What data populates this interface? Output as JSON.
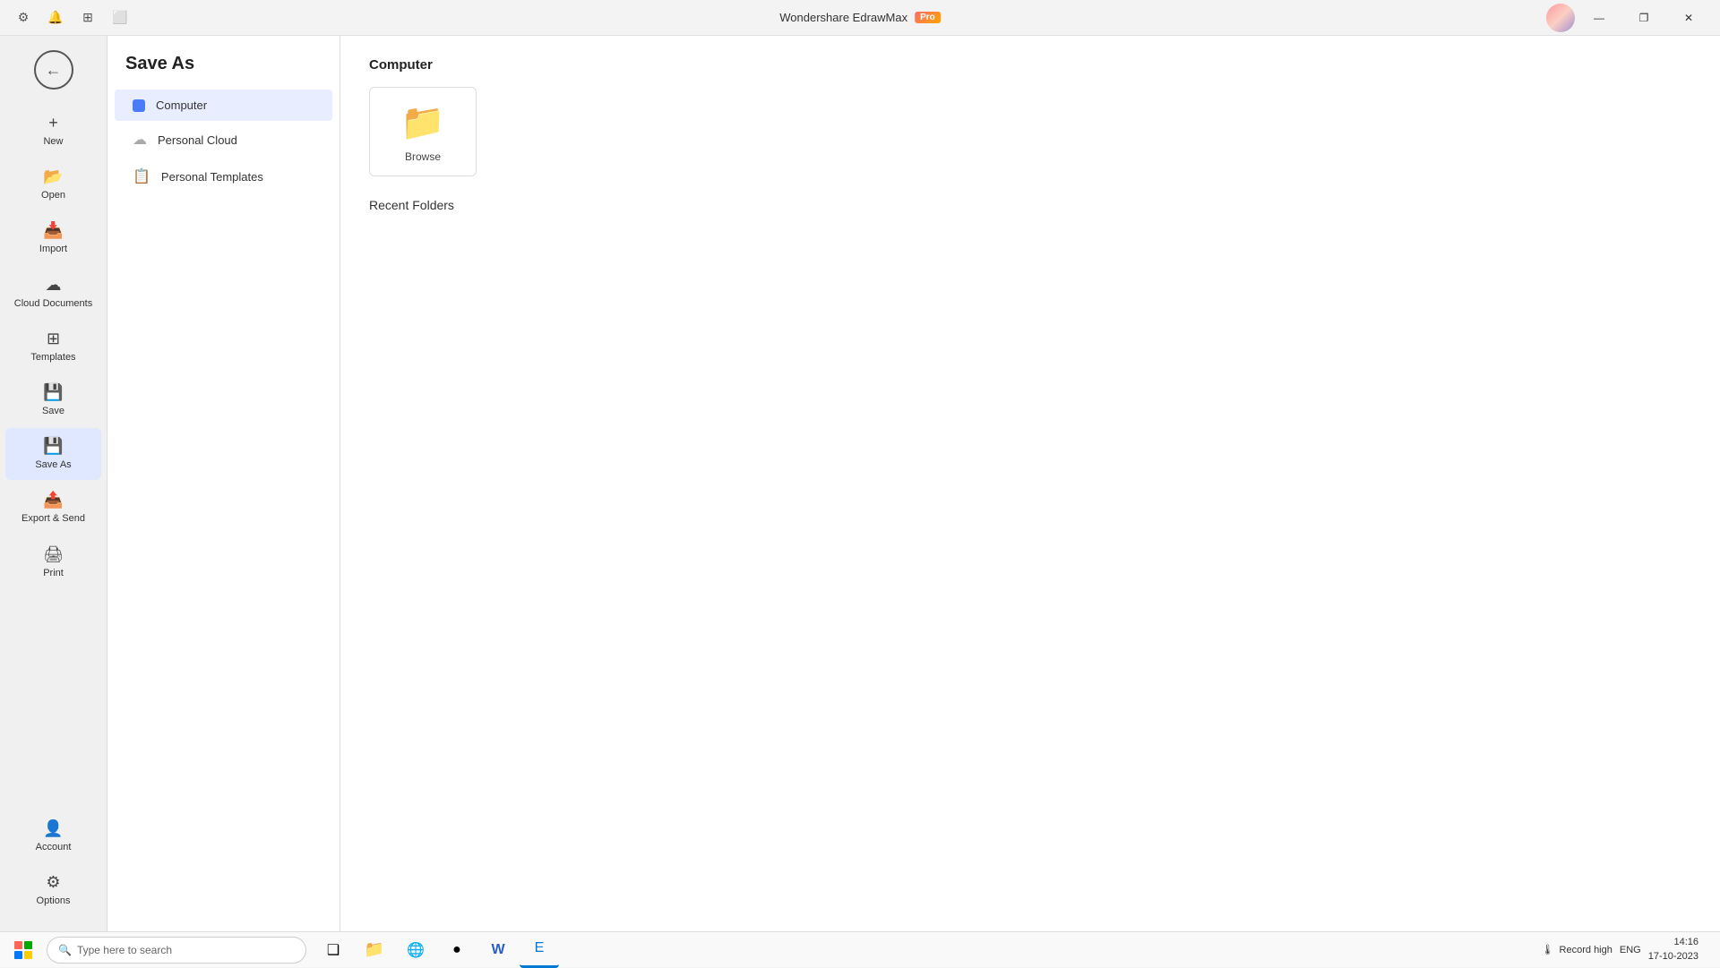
{
  "app": {
    "title": "Wondershare EdrawMax",
    "pro_badge": "Pro"
  },
  "titlebar": {
    "minimize": "—",
    "restore": "❐",
    "close": "✕"
  },
  "toolbar": {
    "icons": [
      "⚙",
      "🔔",
      "⊞",
      "⬜"
    ]
  },
  "sidebar": {
    "items": [
      {
        "id": "new",
        "label": "New",
        "icon": "+"
      },
      {
        "id": "open",
        "label": "Open",
        "icon": "📂"
      },
      {
        "id": "import",
        "label": "Import",
        "icon": "📥"
      },
      {
        "id": "cloud-docs",
        "label": "Cloud Documents",
        "icon": "☁"
      },
      {
        "id": "templates",
        "label": "Templates",
        "icon": "⊞"
      },
      {
        "id": "save",
        "label": "Save",
        "icon": "💾"
      },
      {
        "id": "save-as",
        "label": "Save As",
        "icon": "💾",
        "active": true
      },
      {
        "id": "export-send",
        "label": "Export & Send",
        "icon": "📤"
      },
      {
        "id": "print",
        "label": "Print",
        "icon": "🖨"
      }
    ],
    "bottom": [
      {
        "id": "account",
        "label": "Account",
        "icon": "👤"
      },
      {
        "id": "options",
        "label": "Options",
        "icon": "⚙"
      }
    ]
  },
  "saveas": {
    "title": "Save As",
    "items": [
      {
        "id": "computer",
        "label": "Computer",
        "active": true
      },
      {
        "id": "personal-cloud",
        "label": "Personal Cloud"
      },
      {
        "id": "personal-templates",
        "label": "Personal Templates"
      }
    ]
  },
  "main": {
    "section_title": "Computer",
    "browse_label": "Browse",
    "recent_folders_title": "Recent Folders"
  },
  "taskbar": {
    "search_placeholder": "Type here to search",
    "apps": [
      {
        "id": "start",
        "icon": "⊞"
      },
      {
        "id": "taskview",
        "icon": "❑"
      },
      {
        "id": "file-explorer",
        "icon": "📁"
      },
      {
        "id": "edge",
        "icon": "🌐"
      },
      {
        "id": "chrome",
        "icon": "●"
      },
      {
        "id": "word",
        "icon": "W"
      },
      {
        "id": "edrawmax",
        "icon": "E",
        "active": true
      }
    ],
    "sys": {
      "weather": "Record high",
      "time": "14:16",
      "date": "17-10-2023",
      "lang": "ENG"
    }
  }
}
